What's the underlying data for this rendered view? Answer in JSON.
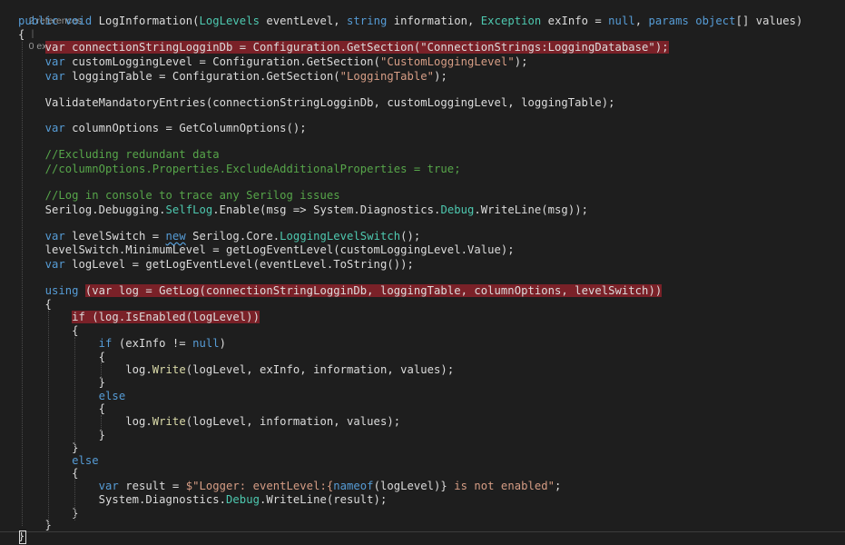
{
  "codelens": {
    "references": "2 references",
    "separator": "|",
    "exceptions": "0 exceptions"
  },
  "code_lines": [
    [
      [
        "public",
        "kw"
      ],
      [
        " ",
        "pl"
      ],
      [
        "void",
        "kw"
      ],
      [
        " LogInformation(",
        "pl"
      ],
      [
        "LogLevels",
        "ty"
      ],
      [
        " eventLevel, ",
        "pl"
      ],
      [
        "string",
        "kw"
      ],
      [
        " information, ",
        "pl"
      ],
      [
        "Exception",
        "ty"
      ],
      [
        " exInfo = ",
        "pl"
      ],
      [
        "null",
        "kw"
      ],
      [
        ", ",
        "pl"
      ],
      [
        "params",
        "kw"
      ],
      [
        " ",
        "pl"
      ],
      [
        "object",
        "kw"
      ],
      [
        "[] values)",
        "pl"
      ]
    ],
    [
      [
        "{",
        "pl"
      ]
    ],
    [
      [
        "    ",
        "pl"
      ],
      [
        "var connectionStringLogginDb = Configuration.GetSection(\"ConnectionStrings:LoggingDatabase\");",
        "hl"
      ]
    ],
    [
      [
        "    ",
        "pl"
      ],
      [
        "var",
        "kw"
      ],
      [
        " customLoggingLevel = Configuration.GetSection(",
        "pl"
      ],
      [
        "\"CustomLoggingLevel\"",
        "str"
      ],
      [
        ");",
        "pl"
      ]
    ],
    [
      [
        "    ",
        "pl"
      ],
      [
        "var",
        "kw"
      ],
      [
        " loggingTable = Configuration.GetSection(",
        "pl"
      ],
      [
        "\"LoggingTable\"",
        "str"
      ],
      [
        ");",
        "pl"
      ]
    ],
    [],
    [
      [
        "    ",
        "pl"
      ],
      [
        "ValidateMandatoryEntries(connectionStringLogginDb, customLoggingLevel, loggingTable);",
        "pl"
      ]
    ],
    [],
    [
      [
        "    ",
        "pl"
      ],
      [
        "var",
        "kw"
      ],
      [
        " columnOptions = GetColumnOptions();",
        "pl"
      ]
    ],
    [],
    [
      [
        "    ",
        "pl"
      ],
      [
        "//Excluding redundant data",
        "cm"
      ]
    ],
    [
      [
        "    ",
        "pl"
      ],
      [
        "//columnOptions.Properties.ExcludeAdditionalProperties = true;",
        "cm"
      ]
    ],
    [],
    [
      [
        "    ",
        "pl"
      ],
      [
        "//Log in console to trace any Serilog issues",
        "cm"
      ]
    ],
    [
      [
        "    ",
        "pl"
      ],
      [
        "Serilog.Debugging.",
        "pl"
      ],
      [
        "SelfLog",
        "ty"
      ],
      [
        ".Enable(msg => System.Diagnostics.",
        "pl"
      ],
      [
        "Debug",
        "ty"
      ],
      [
        ".WriteLine(msg));",
        "pl"
      ]
    ],
    [],
    [
      [
        "    ",
        "pl"
      ],
      [
        "var",
        "kw"
      ],
      [
        " levelSwitch = ",
        "pl"
      ],
      [
        "new",
        "sq"
      ],
      [
        " Serilog.Core.",
        "pl"
      ],
      [
        "LoggingLevelSwitch",
        "ty"
      ],
      [
        "();",
        "pl"
      ]
    ],
    [
      [
        "    ",
        "pl"
      ],
      [
        "levelSwitch.MinimumLevel = getLogEventLevel(customLoggingLevel.Value);",
        "pl"
      ]
    ],
    [
      [
        "    ",
        "pl"
      ],
      [
        "var",
        "kw"
      ],
      [
        " logLevel = getLogEventLevel(eventLevel.ToString());",
        "pl"
      ]
    ],
    [],
    [
      [
        "    ",
        "pl"
      ],
      [
        "using",
        "kw"
      ],
      [
        " ",
        "pl"
      ],
      [
        "(var log = GetLog(connectionStringLogginDb, loggingTable, columnOptions, levelSwitch))",
        "hl"
      ]
    ],
    [
      [
        "    {",
        "pl"
      ]
    ],
    [
      [
        "        ",
        "pl"
      ],
      [
        "if (log.IsEnabled(logLevel))",
        "hl"
      ]
    ],
    [
      [
        "        {",
        "pl"
      ]
    ],
    [
      [
        "            ",
        "pl"
      ],
      [
        "if",
        "kw"
      ],
      [
        " (exInfo != ",
        "pl"
      ],
      [
        "null",
        "kw"
      ],
      [
        ")",
        "pl"
      ]
    ],
    [
      [
        "            {",
        "pl"
      ]
    ],
    [
      [
        "                ",
        "pl"
      ],
      [
        "log.",
        "pl"
      ],
      [
        "Write",
        "fn"
      ],
      [
        "(logLevel, exInfo, information, values);",
        "pl"
      ]
    ],
    [
      [
        "            }",
        "pl"
      ]
    ],
    [
      [
        "            ",
        "pl"
      ],
      [
        "else",
        "kw"
      ]
    ],
    [
      [
        "            {",
        "pl"
      ]
    ],
    [
      [
        "                ",
        "pl"
      ],
      [
        "log.",
        "pl"
      ],
      [
        "Write",
        "fn"
      ],
      [
        "(logLevel, information, values);",
        "pl"
      ]
    ],
    [
      [
        "            }",
        "pl"
      ]
    ],
    [
      [
        "        }",
        "pl"
      ]
    ],
    [
      [
        "        ",
        "pl"
      ],
      [
        "else",
        "kw"
      ]
    ],
    [
      [
        "        {",
        "pl"
      ]
    ],
    [
      [
        "            ",
        "pl"
      ],
      [
        "var",
        "kw"
      ],
      [
        " result = ",
        "pl"
      ],
      [
        "$\"Logger: eventLevel:{",
        "str"
      ],
      [
        "nameof",
        "kw"
      ],
      [
        "(logLevel)}",
        "pl"
      ],
      [
        " is not enabled\"",
        "str"
      ],
      [
        ";",
        "pl"
      ]
    ],
    [
      [
        "            ",
        "pl"
      ],
      [
        "System.Diagnostics.",
        "pl"
      ],
      [
        "Debug",
        "ty"
      ],
      [
        ".WriteLine(result);",
        "pl"
      ]
    ],
    [
      [
        "        }",
        "pl"
      ]
    ],
    [
      [
        "    }",
        "pl"
      ]
    ],
    [
      [
        "}",
        "pl"
      ]
    ]
  ]
}
